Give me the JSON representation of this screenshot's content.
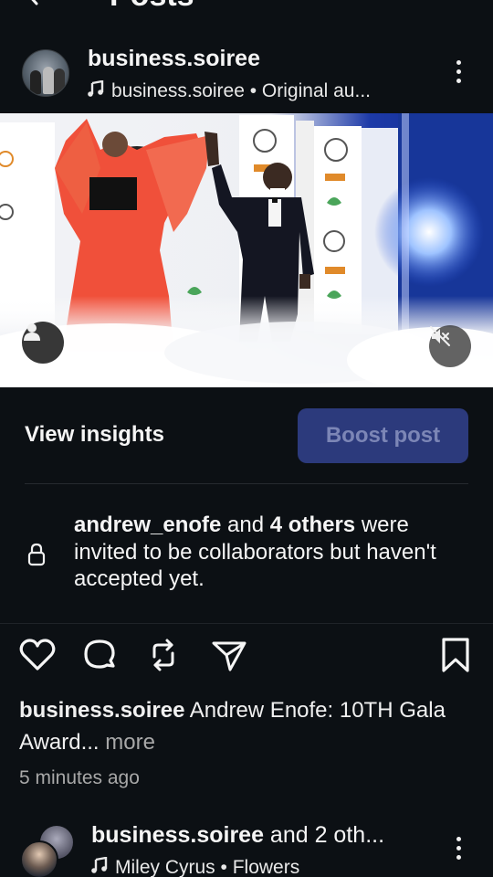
{
  "header": {
    "title": "Posts"
  },
  "post": {
    "username": "business.soiree",
    "audio": "business.soiree • Original au...",
    "insights_label": "View insights",
    "boost_label": "Boost post",
    "collab": {
      "user": "andrew_enofe",
      "connector": " and ",
      "others": "4 others",
      "rest": " were invited to be collaborators but haven't accepted yet."
    },
    "caption": {
      "user": "business.soiree",
      "text": " Andrew Enofe:  10TH Gala Award...",
      "more": " more"
    },
    "timestamp": "5 minutes ago",
    "icons": {
      "like": "heart-icon",
      "comment": "comment-icon",
      "repost": "repost-icon",
      "share": "send-icon",
      "save": "bookmark-icon",
      "mute": "speaker-muted-icon",
      "tags": "person-icon",
      "lock": "lock-icon"
    }
  },
  "next_post": {
    "username": "business.soiree",
    "suffix": " and 2 oth...",
    "audio": "Miley Cyrus • Flowers"
  },
  "colors": {
    "background": "#0c1014",
    "boost_button": "#2c3a7c",
    "boost_text": "#7c86b6",
    "muted_text": "#a8a8a8"
  }
}
